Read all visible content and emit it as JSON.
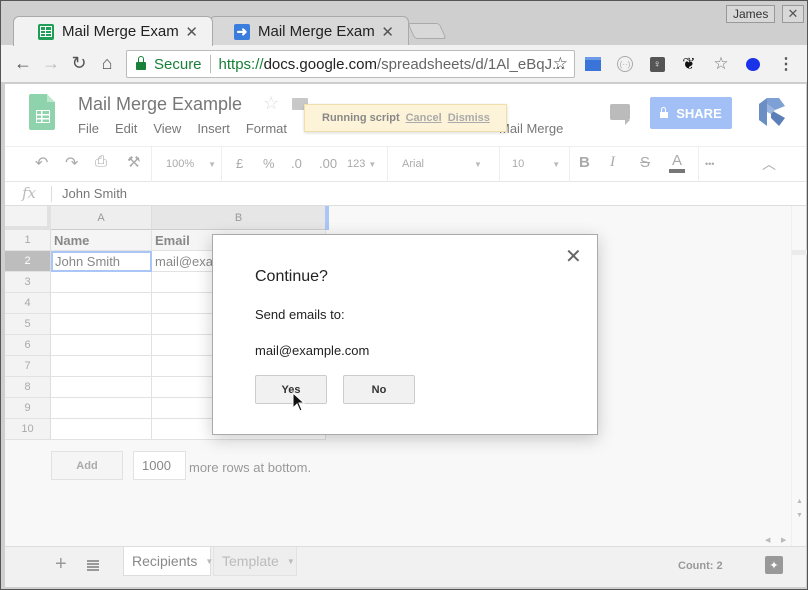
{
  "browser": {
    "tabs": [
      {
        "title": "Mail Merge Example",
        "icon": "sheets-icon",
        "active": true
      },
      {
        "title": "Mail Merge Example",
        "icon": "script-redirect-icon",
        "active": false
      }
    ],
    "profile": "James",
    "url": {
      "secure_label": "Secure",
      "scheme": "https://",
      "host": "docs.google.com",
      "path": "/spreadsheets/d/1Al_eBqJ..."
    },
    "extensions": [
      "blue-square-icon",
      "code-bracket-icon",
      "lightbulb-icon",
      "pawprint-icon",
      "star-plus-icon",
      "blue-globe-icon"
    ]
  },
  "doc": {
    "title": "Mail Merge Example",
    "menu": [
      "File",
      "Edit",
      "View",
      "Insert",
      "Format"
    ],
    "menu_extra": "Mail Merge",
    "toast": {
      "text": "Running script",
      "cancel": "Cancel",
      "dismiss": "Dismiss"
    },
    "share_label": "SHARE"
  },
  "toolbar": {
    "zoom": "100%",
    "currency": "£",
    "percent": "%",
    "dec_decrease": ".0",
    "dec_increase": ".00",
    "number_format": "123",
    "font": "Arial",
    "font_size": "10",
    "bold": "B",
    "italic": "I",
    "strike": "S",
    "text_color": "A",
    "more": "•••"
  },
  "formula_bar": {
    "fx": "fx",
    "value": "John Smith"
  },
  "grid": {
    "columns": [
      "A",
      "B"
    ],
    "rows": [
      "1",
      "2",
      "3",
      "4",
      "5",
      "6",
      "7",
      "8",
      "9",
      "10"
    ],
    "cells": [
      [
        "Name",
        "Email"
      ],
      [
        "John Smith",
        "mail@example.com"
      ]
    ],
    "add_button": "Add",
    "rows_to_add": "1000",
    "more_rows_text": "more rows at bottom."
  },
  "sheets": [
    {
      "name": "Recipients",
      "active": true
    },
    {
      "name": "Template",
      "active": false
    }
  ],
  "status": {
    "count": "Count: 2"
  },
  "dialog": {
    "title": "Continue?",
    "message": "Send emails to:",
    "email": "mail@example.com",
    "yes": "Yes",
    "no": "No"
  }
}
